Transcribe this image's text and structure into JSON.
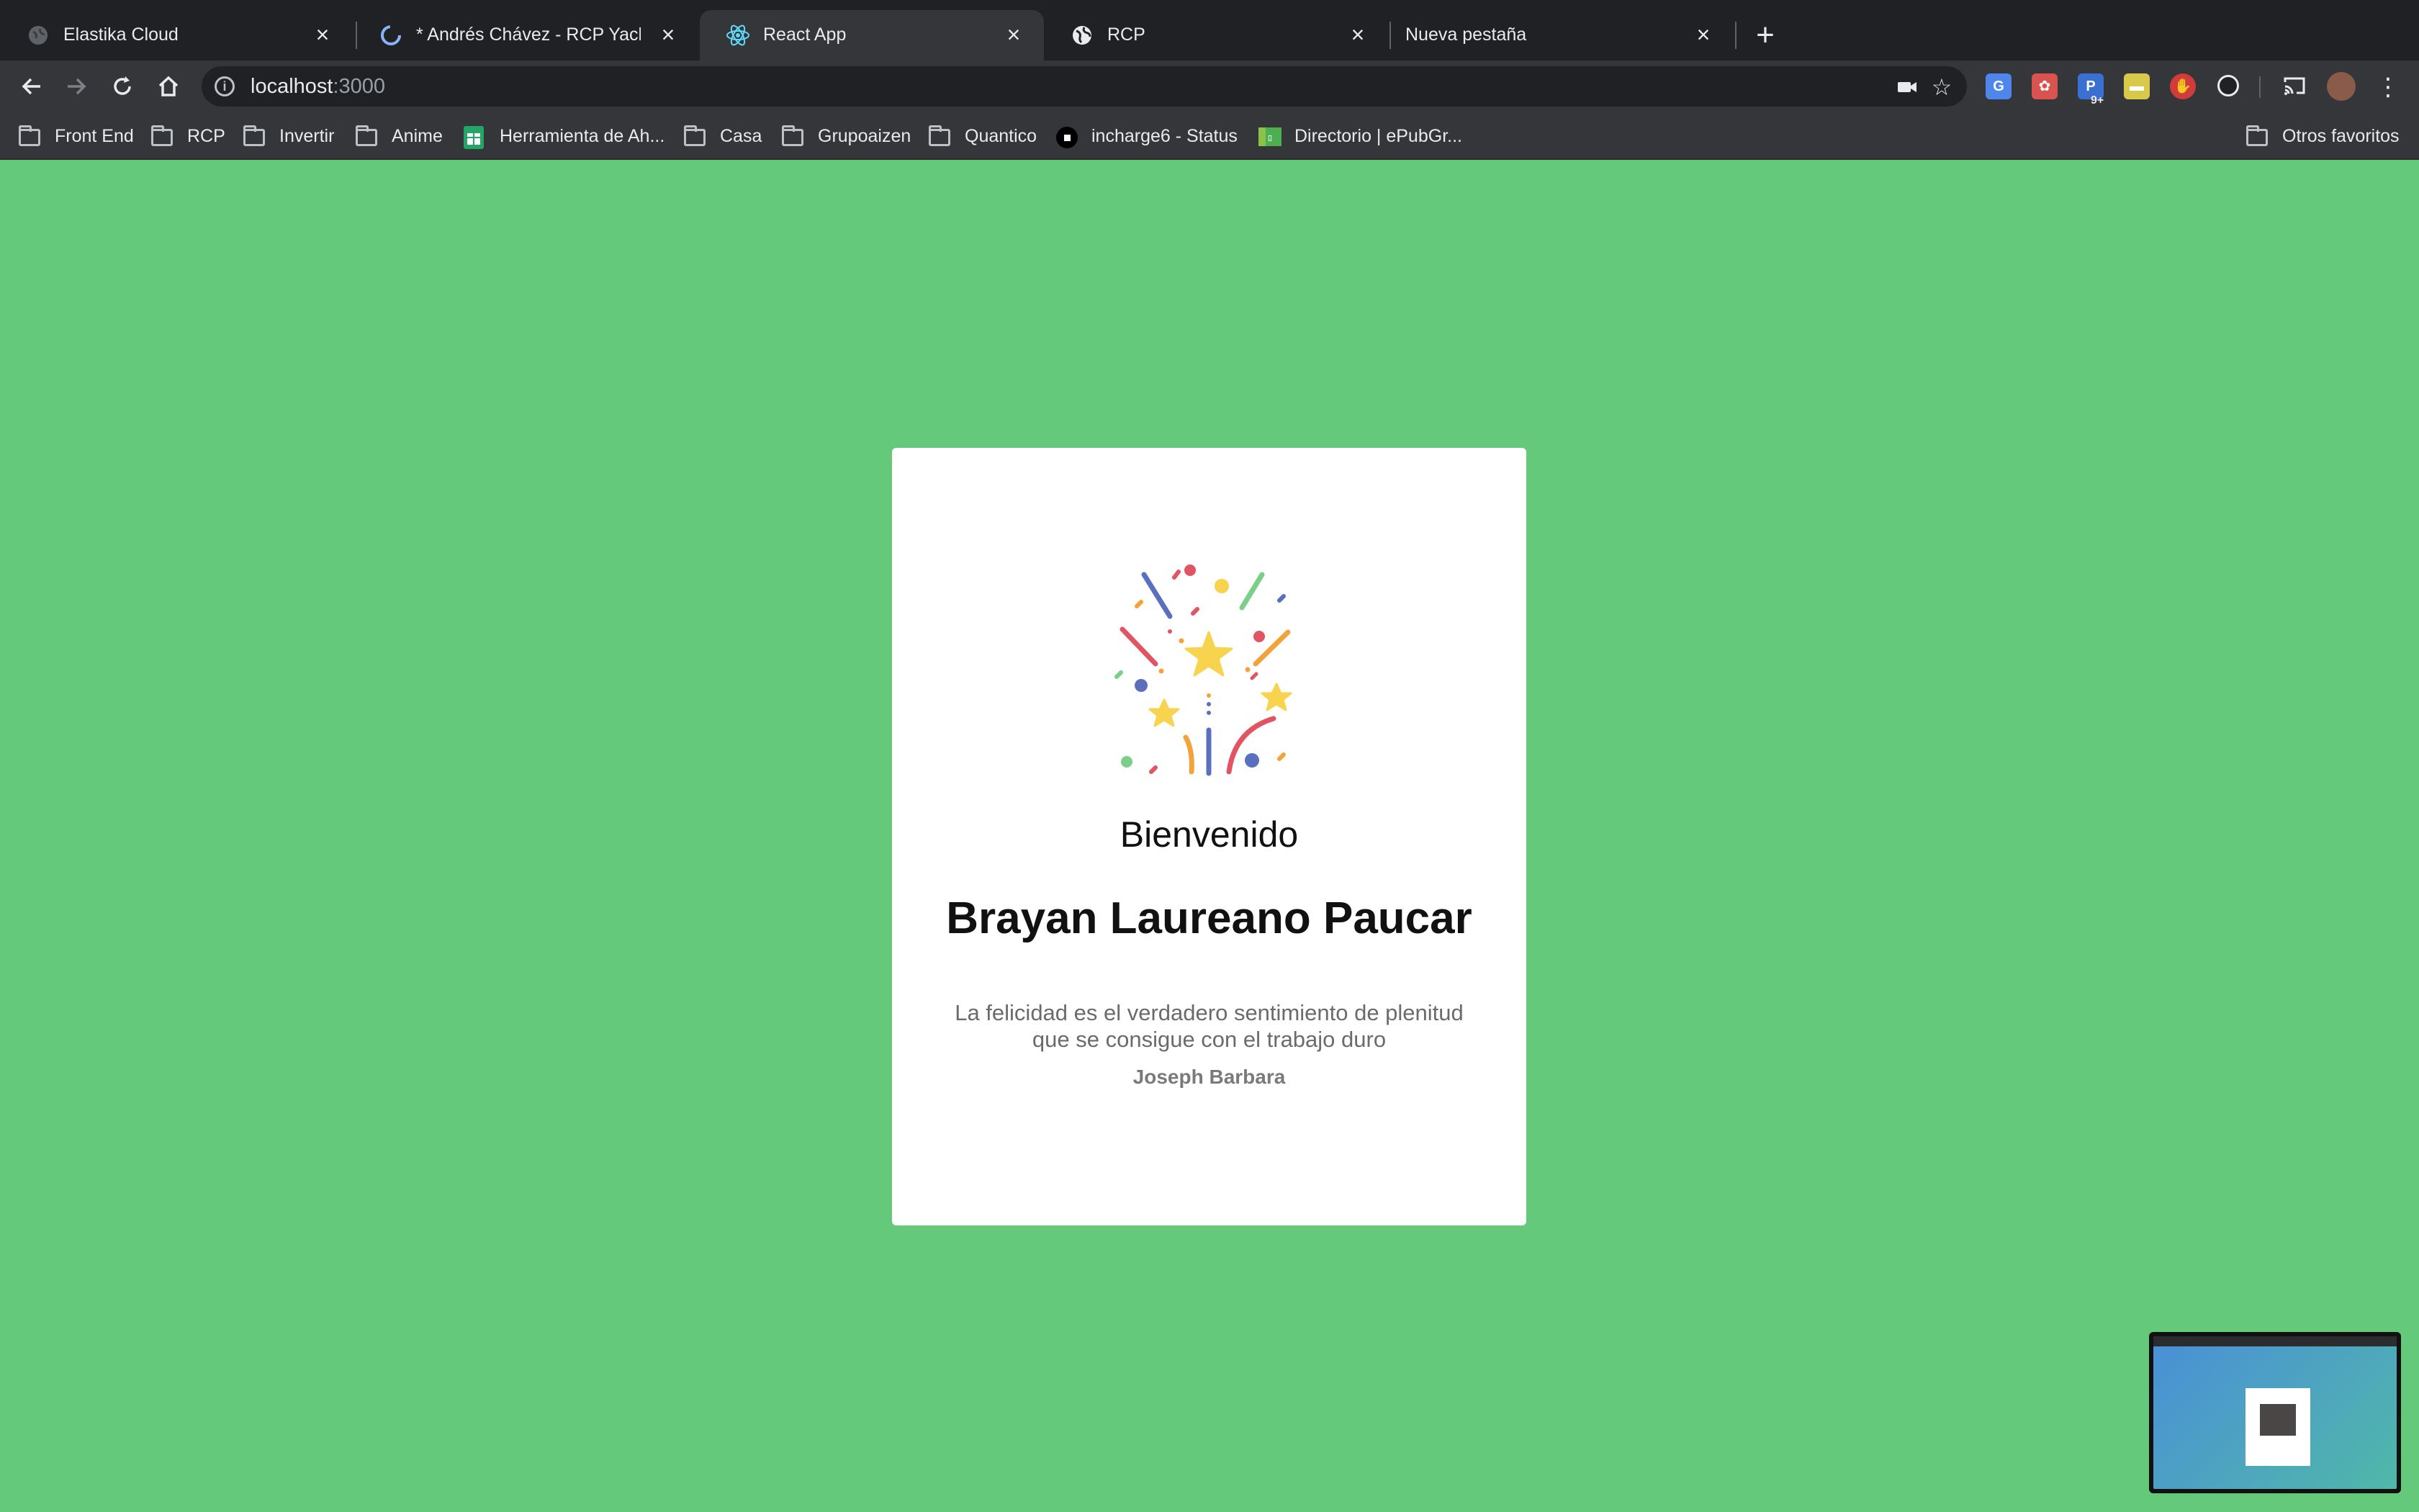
{
  "browser": {
    "tabs": [
      {
        "title": "Elastika Cloud",
        "favicon": "globe-icon",
        "active": false
      },
      {
        "title": "* Andrés Chávez - RCP Yachay M",
        "favicon": "loading-icon",
        "active": false
      },
      {
        "title": "React App",
        "favicon": "react-icon",
        "active": true
      },
      {
        "title": "RCP",
        "favicon": "globe-icon",
        "active": false
      },
      {
        "title": "Nueva pestaña",
        "favicon": "none",
        "active": false
      }
    ],
    "address": {
      "host": "localhost",
      "port": ":3000"
    },
    "extension_badge": "9+",
    "bookmarks": [
      {
        "label": "Front End",
        "icon": "folder-icon"
      },
      {
        "label": "RCP",
        "icon": "folder-icon"
      },
      {
        "label": "Invertir",
        "icon": "folder-icon"
      },
      {
        "label": "Anime",
        "icon": "folder-icon"
      },
      {
        "label": "Herramienta de Ah...",
        "icon": "sheets-icon"
      },
      {
        "label": "Casa",
        "icon": "folder-icon"
      },
      {
        "label": "Grupoaizen",
        "icon": "folder-icon"
      },
      {
        "label": "Quantico",
        "icon": "folder-icon"
      },
      {
        "label": "incharge6 - Status",
        "icon": "status-icon"
      },
      {
        "label": "Directorio | ePubGr...",
        "icon": "epub-icon"
      }
    ],
    "other_bookmarks": "Otros favoritos"
  },
  "page": {
    "background": "#64c97b",
    "illustration": "confetti-stars-icon",
    "welcome": "Bienvenido",
    "user_name": "Brayan Laureano Paucar",
    "quote_line1": "La felicidad es el verdadero sentimiento de plenitud",
    "quote_line2": "que se consigue con el trabajo duro",
    "author": "Joseph Barbara"
  }
}
